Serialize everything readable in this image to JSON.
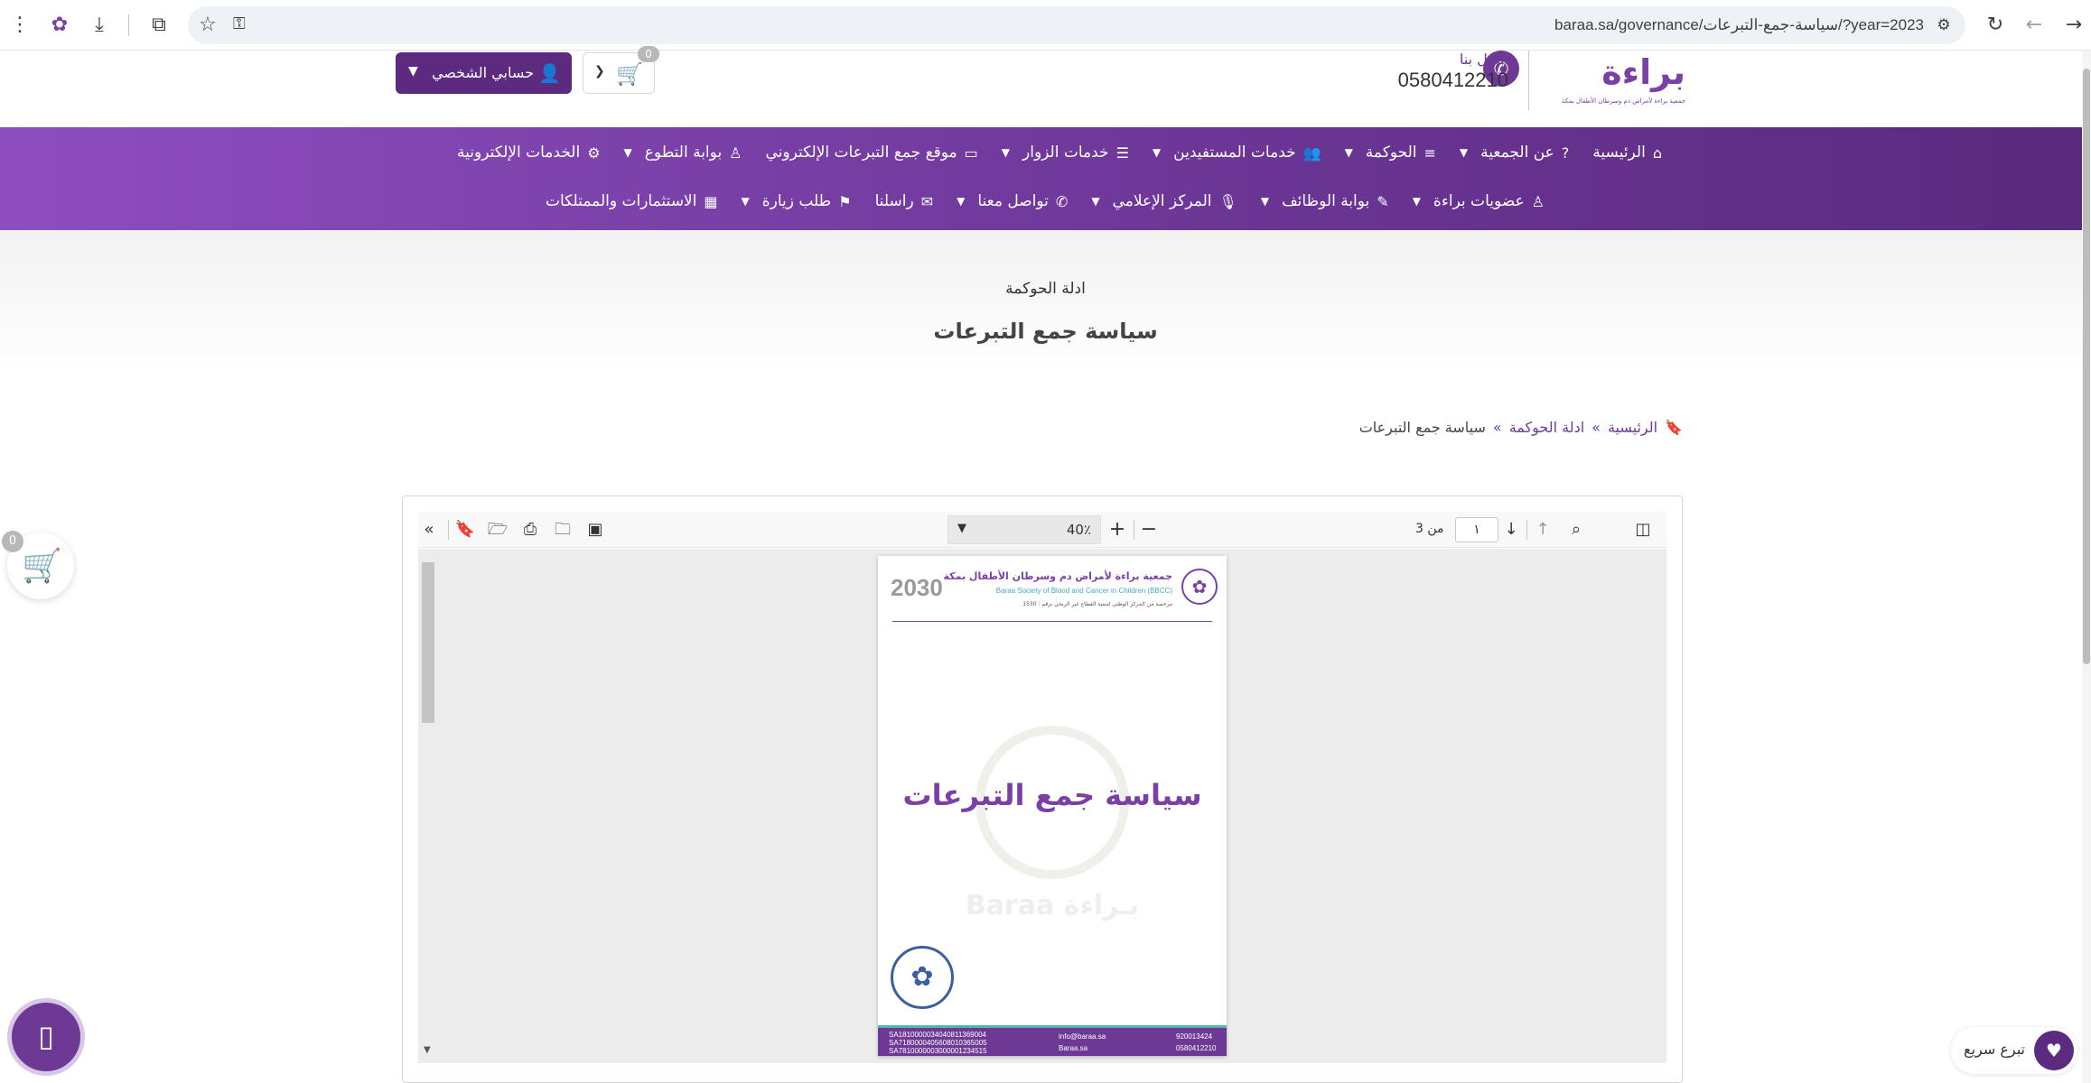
{
  "browser": {
    "url": "baraa.sa/governance/سياسة-جمع-التبرعات/?year=2023",
    "icons": [
      "arrow-right-icon",
      "arrow-left-icon",
      "reload-icon",
      "tune-icon",
      "star-icon",
      "key-icon",
      "extensions-icon",
      "download-icon",
      "profile-icon",
      "menu-icon"
    ]
  },
  "header": {
    "brand": "براءة",
    "brand_tagline": "جمعية براءة لأمراض دم وسرطان الأطفال بمكة",
    "contact_label": "اتصل بنا",
    "contact_phone": "0580412210",
    "cart_count": "0",
    "account_label": "حسابي الشخصي"
  },
  "nav": {
    "row1": [
      {
        "label": "الرئيسية",
        "icon": "home-icon",
        "has_dropdown": false
      },
      {
        "label": "عن الجمعية",
        "icon": "help-circle-icon",
        "has_dropdown": true
      },
      {
        "label": "الحوكمة",
        "icon": "list-icon",
        "has_dropdown": true
      },
      {
        "label": "خدمات المستفيدين",
        "icon": "users-icon",
        "has_dropdown": true
      },
      {
        "label": "خدمات الزوار",
        "icon": "server-icon",
        "has_dropdown": true
      },
      {
        "label": "موقع جمع التبرعات الإلكتروني",
        "icon": "card-icon",
        "has_dropdown": false
      },
      {
        "label": "بوابة التطوع",
        "icon": "person-icon",
        "has_dropdown": true
      },
      {
        "label": "الخدمات الإلكترونية",
        "icon": "cogs-icon",
        "has_dropdown": false
      }
    ],
    "row2": [
      {
        "label": "عضويات براءة",
        "icon": "user-icon",
        "has_dropdown": true
      },
      {
        "label": "بوابة الوظائف",
        "icon": "edit-icon",
        "has_dropdown": true
      },
      {
        "label": "المركز الإعلامي",
        "icon": "mic-icon",
        "has_dropdown": true
      },
      {
        "label": "تواصل معنا",
        "icon": "phone-icon",
        "has_dropdown": true
      },
      {
        "label": "راسلنا",
        "icon": "mail-icon",
        "has_dropdown": false
      },
      {
        "label": "طلب زيارة",
        "icon": "visit-icon",
        "has_dropdown": true
      },
      {
        "label": "الاستثمارات والممتلكات",
        "icon": "building-icon",
        "has_dropdown": false
      }
    ]
  },
  "hero": {
    "subtitle": "ادلة الحوكمة",
    "title": "سياسة جمع التبرعات"
  },
  "breadcrumb": {
    "home": "الرئيسية",
    "section": "ادلة الحوكمة",
    "current": "سياسة جمع التبرعات",
    "separator": "»"
  },
  "viewer": {
    "zoom": "40٪",
    "page_current": "١",
    "page_total_label": "من 3",
    "document": {
      "org_ar": "جمعية براءة لأمراض دم وسرطان الأطفال بمكة",
      "org_en": "Baraa Society of Blood and Cancer in Children (BBCC)",
      "registration": "مرخصة من المركز الوطني لتنمية القطاع غير الربحي برقم : 1530",
      "vision": "2030",
      "title": "سياسة جمع التبرعات",
      "watermark": "Baraa بـراءة",
      "footer_phone1": "920013424",
      "footer_phone2": "0580412210",
      "footer_email": "info@baraa.sa",
      "footer_web": "Baraa.sa",
      "footer_iban1": "SA1810000034040811369004",
      "footer_iban2": "SA7180000405608010365005",
      "footer_iban3": "SA7810000003000001234515"
    }
  },
  "floating": {
    "cart_count": "0",
    "quick_donate": "تبرع سريع"
  }
}
